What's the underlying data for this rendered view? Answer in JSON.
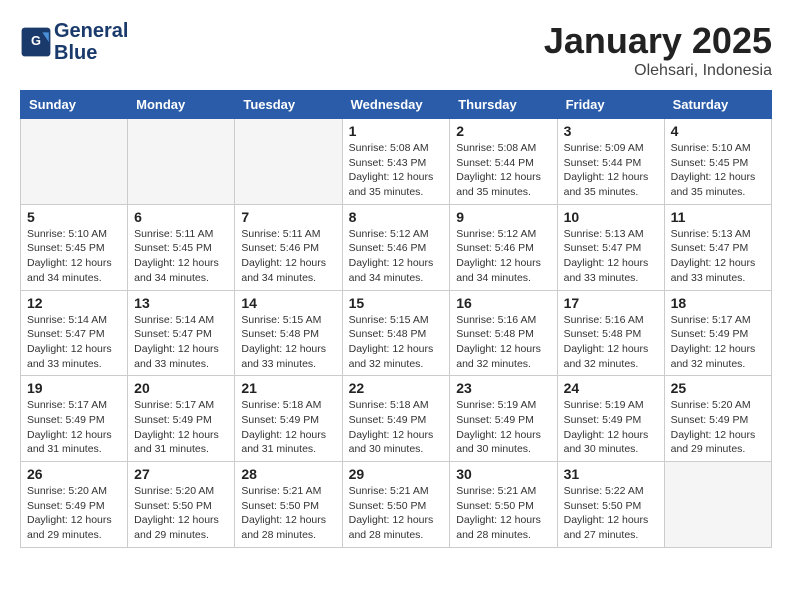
{
  "header": {
    "logo_line1": "General",
    "logo_line2": "Blue",
    "month_title": "January 2025",
    "location": "Olehsari, Indonesia"
  },
  "days_of_week": [
    "Sunday",
    "Monday",
    "Tuesday",
    "Wednesday",
    "Thursday",
    "Friday",
    "Saturday"
  ],
  "weeks": [
    [
      {
        "day": "",
        "info": ""
      },
      {
        "day": "",
        "info": ""
      },
      {
        "day": "",
        "info": ""
      },
      {
        "day": "1",
        "info": "Sunrise: 5:08 AM\nSunset: 5:43 PM\nDaylight: 12 hours\nand 35 minutes."
      },
      {
        "day": "2",
        "info": "Sunrise: 5:08 AM\nSunset: 5:44 PM\nDaylight: 12 hours\nand 35 minutes."
      },
      {
        "day": "3",
        "info": "Sunrise: 5:09 AM\nSunset: 5:44 PM\nDaylight: 12 hours\nand 35 minutes."
      },
      {
        "day": "4",
        "info": "Sunrise: 5:10 AM\nSunset: 5:45 PM\nDaylight: 12 hours\nand 35 minutes."
      }
    ],
    [
      {
        "day": "5",
        "info": "Sunrise: 5:10 AM\nSunset: 5:45 PM\nDaylight: 12 hours\nand 34 minutes."
      },
      {
        "day": "6",
        "info": "Sunrise: 5:11 AM\nSunset: 5:45 PM\nDaylight: 12 hours\nand 34 minutes."
      },
      {
        "day": "7",
        "info": "Sunrise: 5:11 AM\nSunset: 5:46 PM\nDaylight: 12 hours\nand 34 minutes."
      },
      {
        "day": "8",
        "info": "Sunrise: 5:12 AM\nSunset: 5:46 PM\nDaylight: 12 hours\nand 34 minutes."
      },
      {
        "day": "9",
        "info": "Sunrise: 5:12 AM\nSunset: 5:46 PM\nDaylight: 12 hours\nand 34 minutes."
      },
      {
        "day": "10",
        "info": "Sunrise: 5:13 AM\nSunset: 5:47 PM\nDaylight: 12 hours\nand 33 minutes."
      },
      {
        "day": "11",
        "info": "Sunrise: 5:13 AM\nSunset: 5:47 PM\nDaylight: 12 hours\nand 33 minutes."
      }
    ],
    [
      {
        "day": "12",
        "info": "Sunrise: 5:14 AM\nSunset: 5:47 PM\nDaylight: 12 hours\nand 33 minutes."
      },
      {
        "day": "13",
        "info": "Sunrise: 5:14 AM\nSunset: 5:47 PM\nDaylight: 12 hours\nand 33 minutes."
      },
      {
        "day": "14",
        "info": "Sunrise: 5:15 AM\nSunset: 5:48 PM\nDaylight: 12 hours\nand 33 minutes."
      },
      {
        "day": "15",
        "info": "Sunrise: 5:15 AM\nSunset: 5:48 PM\nDaylight: 12 hours\nand 32 minutes."
      },
      {
        "day": "16",
        "info": "Sunrise: 5:16 AM\nSunset: 5:48 PM\nDaylight: 12 hours\nand 32 minutes."
      },
      {
        "day": "17",
        "info": "Sunrise: 5:16 AM\nSunset: 5:48 PM\nDaylight: 12 hours\nand 32 minutes."
      },
      {
        "day": "18",
        "info": "Sunrise: 5:17 AM\nSunset: 5:49 PM\nDaylight: 12 hours\nand 32 minutes."
      }
    ],
    [
      {
        "day": "19",
        "info": "Sunrise: 5:17 AM\nSunset: 5:49 PM\nDaylight: 12 hours\nand 31 minutes."
      },
      {
        "day": "20",
        "info": "Sunrise: 5:17 AM\nSunset: 5:49 PM\nDaylight: 12 hours\nand 31 minutes."
      },
      {
        "day": "21",
        "info": "Sunrise: 5:18 AM\nSunset: 5:49 PM\nDaylight: 12 hours\nand 31 minutes."
      },
      {
        "day": "22",
        "info": "Sunrise: 5:18 AM\nSunset: 5:49 PM\nDaylight: 12 hours\nand 30 minutes."
      },
      {
        "day": "23",
        "info": "Sunrise: 5:19 AM\nSunset: 5:49 PM\nDaylight: 12 hours\nand 30 minutes."
      },
      {
        "day": "24",
        "info": "Sunrise: 5:19 AM\nSunset: 5:49 PM\nDaylight: 12 hours\nand 30 minutes."
      },
      {
        "day": "25",
        "info": "Sunrise: 5:20 AM\nSunset: 5:49 PM\nDaylight: 12 hours\nand 29 minutes."
      }
    ],
    [
      {
        "day": "26",
        "info": "Sunrise: 5:20 AM\nSunset: 5:49 PM\nDaylight: 12 hours\nand 29 minutes."
      },
      {
        "day": "27",
        "info": "Sunrise: 5:20 AM\nSunset: 5:50 PM\nDaylight: 12 hours\nand 29 minutes."
      },
      {
        "day": "28",
        "info": "Sunrise: 5:21 AM\nSunset: 5:50 PM\nDaylight: 12 hours\nand 28 minutes."
      },
      {
        "day": "29",
        "info": "Sunrise: 5:21 AM\nSunset: 5:50 PM\nDaylight: 12 hours\nand 28 minutes."
      },
      {
        "day": "30",
        "info": "Sunrise: 5:21 AM\nSunset: 5:50 PM\nDaylight: 12 hours\nand 28 minutes."
      },
      {
        "day": "31",
        "info": "Sunrise: 5:22 AM\nSunset: 5:50 PM\nDaylight: 12 hours\nand 27 minutes."
      },
      {
        "day": "",
        "info": ""
      }
    ]
  ]
}
